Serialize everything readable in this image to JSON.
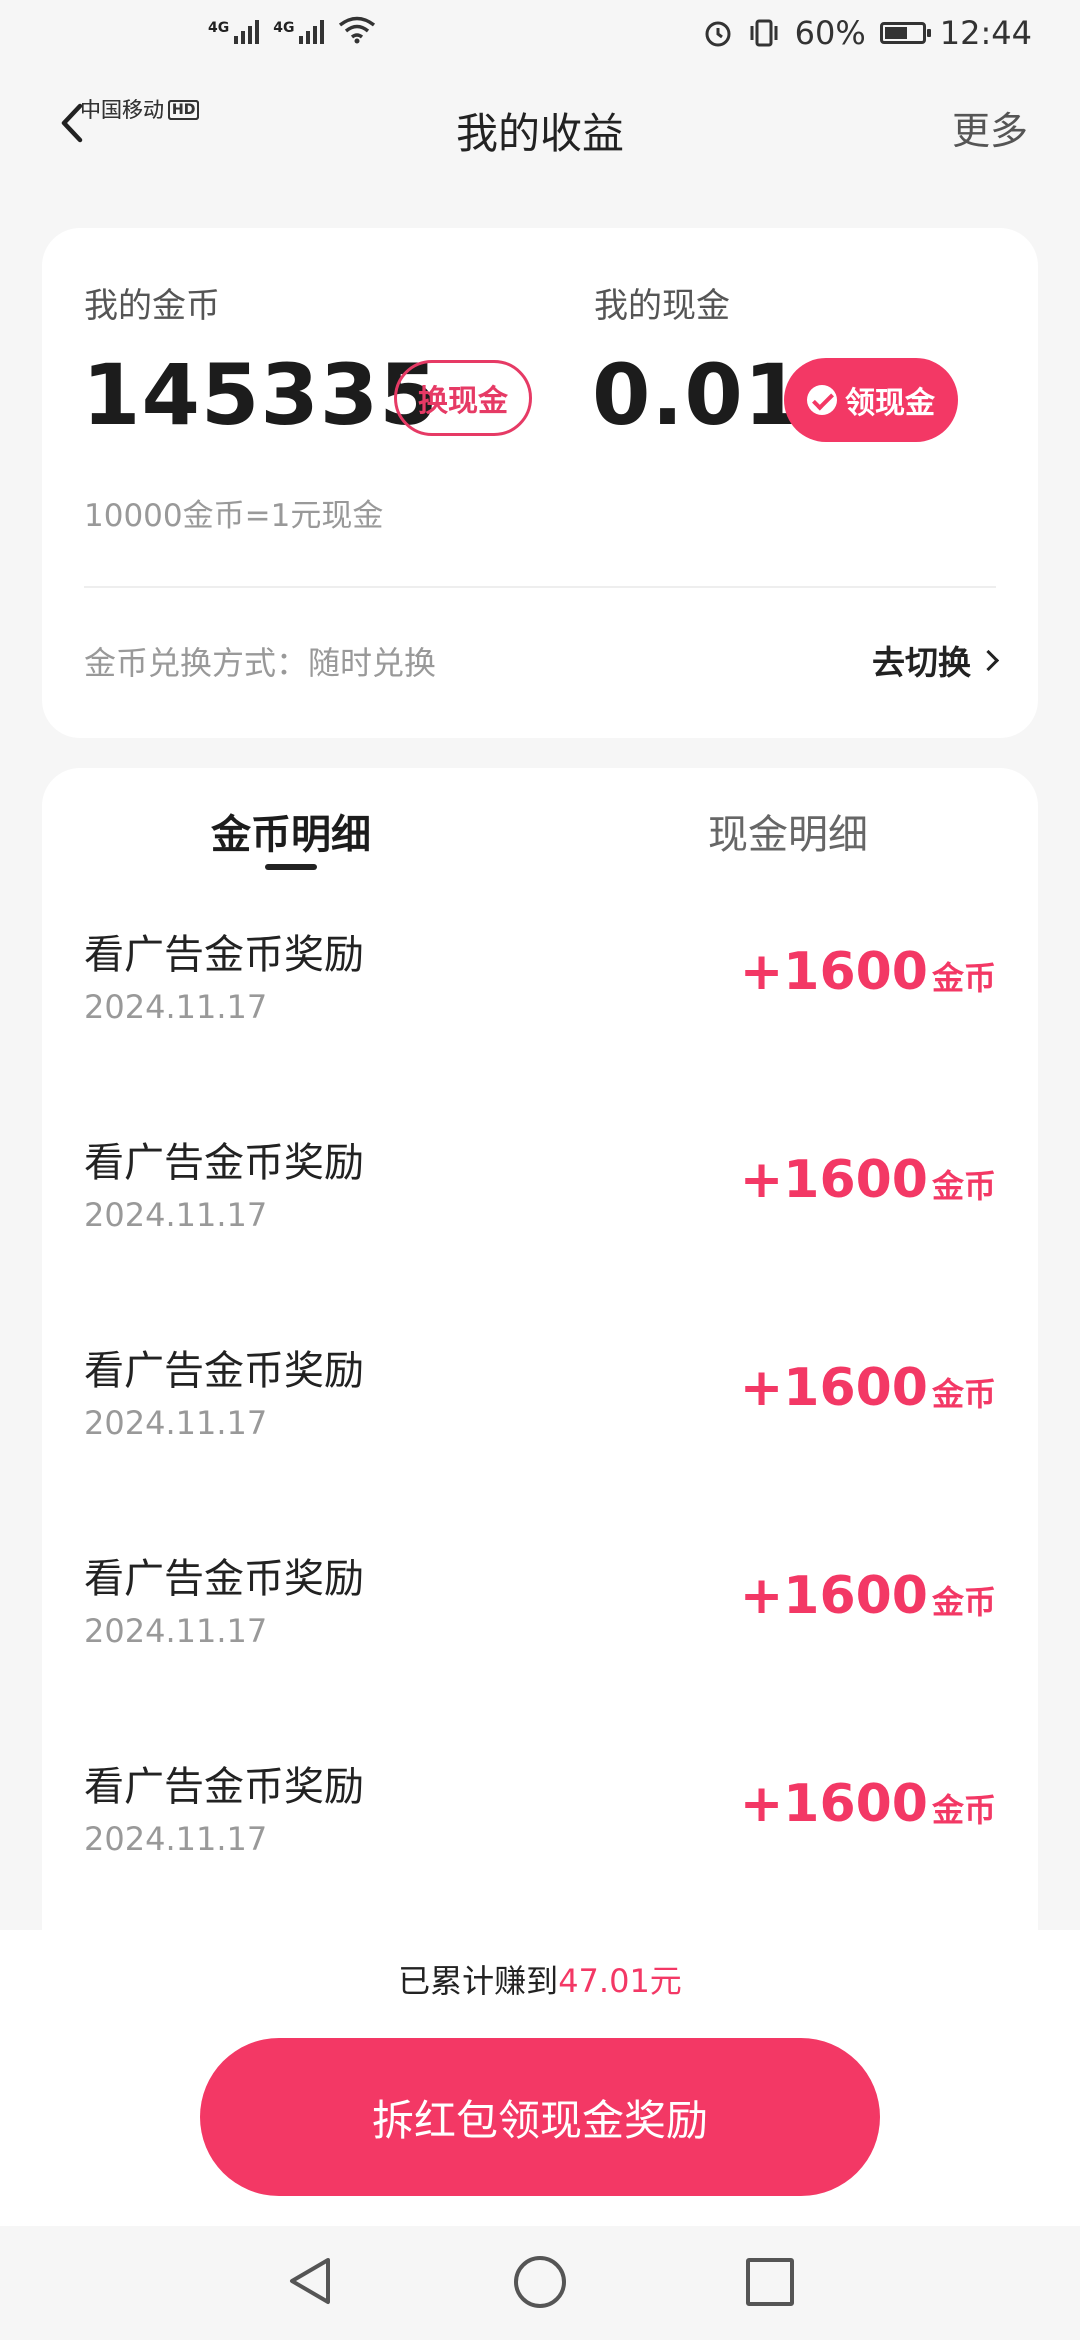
{
  "status_bar": {
    "carrier1": "中国移动",
    "carrier2": "中国移动",
    "hd": "HD",
    "network": "4G",
    "battery_percent": "60%",
    "battery_level": 0.6,
    "time": "12:44"
  },
  "header": {
    "title": "我的收益",
    "more": "更多"
  },
  "summary": {
    "coins_label": "我的金币",
    "coins_value": "145335",
    "exchange_button": "换现金",
    "cash_label": "我的现金",
    "cash_value": "0.01",
    "claim_button": "领现金",
    "rate_text": "10000金币=1元现金",
    "method_text": "金币兑换方式：随时兑换",
    "switch_text": "去切换"
  },
  "tabs": [
    {
      "label": "金币明细",
      "active": true
    },
    {
      "label": "现金明细",
      "active": false
    }
  ],
  "records": [
    {
      "title": "看广告金币奖励",
      "date": "2024.11.17",
      "amount": "+1600",
      "unit": "金币"
    },
    {
      "title": "看广告金币奖励",
      "date": "2024.11.17",
      "amount": "+1600",
      "unit": "金币"
    },
    {
      "title": "看广告金币奖励",
      "date": "2024.11.17",
      "amount": "+1600",
      "unit": "金币"
    },
    {
      "title": "看广告金币奖励",
      "date": "2024.11.17",
      "amount": "+1600",
      "unit": "金币"
    },
    {
      "title": "看广告金币奖励",
      "date": "2024.11.17",
      "amount": "+1600",
      "unit": "金币"
    }
  ],
  "footer": {
    "total_prefix": "已累计赚到",
    "total_amount": "47.01元",
    "cta": "拆红包领现金奖励"
  },
  "colors": {
    "accent": "#f33865",
    "background": "#f6f6f6"
  }
}
